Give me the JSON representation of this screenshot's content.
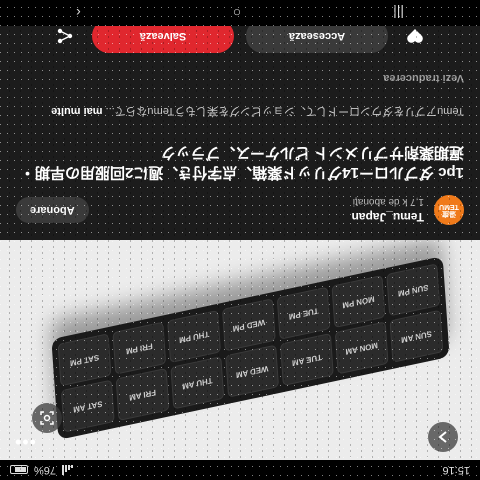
{
  "status": {
    "time": "15:16",
    "battery": "76%"
  },
  "pillbox": {
    "days": [
      "SUN AM",
      "MON AM",
      "TUE AM",
      "WED AM",
      "THU AM",
      "FRI AM",
      "SAT AM",
      "SUN PM",
      "MON PM",
      "TUE PM",
      "WED PM",
      "THU PM",
      "FRI PM",
      "SAT PM"
    ]
  },
  "creator": {
    "avatar_text": "TEMU",
    "avatar_subtext": "温度",
    "name": "Temu_Japan",
    "followers": "1,7 k de abonați",
    "follow_label": "Abonare"
  },
  "product": {
    "title": "1pc ダブルロー14グリッド薬箱、点字付き、週に2回服用の早期・遅期薬剤サプリメント ピルケース、ブラック",
    "description": "Temuアプリをダウンロードして、ショッピングを楽しもうTemuならで...",
    "more_label": "mai multe",
    "translate_label": "Vezi traducerea"
  },
  "actions": {
    "access_label": "Accesează",
    "save_label": "Salvează"
  },
  "icons": {
    "menu": "three-dots-icon",
    "close": "chevron-icon",
    "lens": "lens-search-icon",
    "like": "heart-icon",
    "share": "share-icon"
  },
  "colors": {
    "save": "#e0272e",
    "avatar": "#f07a1a",
    "background": "#1c1c1c"
  }
}
